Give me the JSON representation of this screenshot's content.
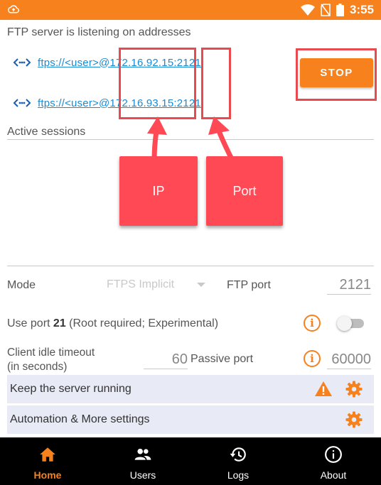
{
  "status_bar": {
    "time": "3:55",
    "color": "#f7811d"
  },
  "server": {
    "listening_label": "FTP server is listening on addresses",
    "addresses": [
      "ftps://<user>@172.16.92.15:2121",
      "ftps://<user>@172.16.93.15:2121"
    ],
    "stop_label": "STOP"
  },
  "annotations": {
    "ip_label": "IP",
    "port_label": "Port",
    "color": "#ff4a55"
  },
  "sessions": {
    "label": "Active sessions"
  },
  "settings": {
    "mode_label": "Mode",
    "mode_value": "FTPS Implicit",
    "ftp_port_label": "FTP port",
    "ftp_port_value": "2121",
    "use_port_prefix": "Use port ",
    "use_port_number": "21",
    "use_port_suffix": " (Root required; Experimental)",
    "use_port_enabled": false,
    "idle_timeout_label_1": "Client idle timeout",
    "idle_timeout_label_2": "(in seconds)",
    "idle_timeout_value": "60",
    "passive_port_label": "Passive port",
    "passive_port_value": "60000",
    "keep_running_label": "Keep the server running",
    "automation_label": "Automation & More settings"
  },
  "nav": {
    "items": [
      {
        "label": "Home",
        "icon": "home-icon",
        "active": true
      },
      {
        "label": "Users",
        "icon": "users-icon",
        "active": false
      },
      {
        "label": "Logs",
        "icon": "history-icon",
        "active": false
      },
      {
        "label": "About",
        "icon": "info-icon",
        "active": false
      }
    ]
  }
}
